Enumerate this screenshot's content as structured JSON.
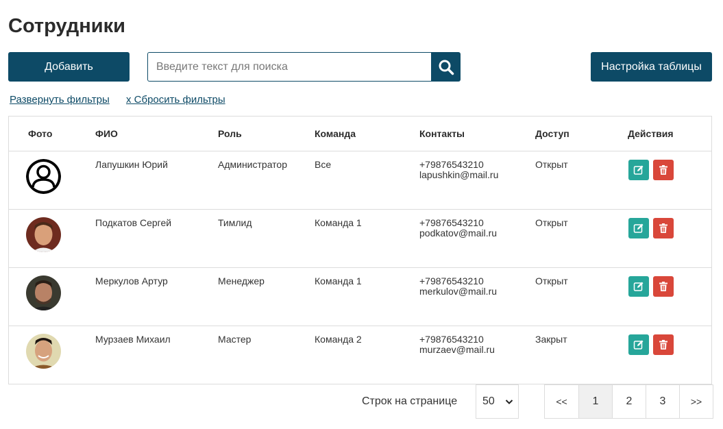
{
  "page": {
    "title": "Сотрудники"
  },
  "toolbar": {
    "add_label": "Добавить",
    "search_placeholder": "Введите текст для поиска",
    "search_value": "",
    "settings_label": "Настройка таблицы"
  },
  "filters": {
    "expand_label": "Развернуть фильтры",
    "reset_label": "x Сбросить фильтры"
  },
  "table": {
    "headers": [
      "Фото",
      "ФИО",
      "Роль",
      "Команда",
      "Контакты",
      "Доступ",
      "Действия"
    ],
    "rows": [
      {
        "name": "Лапушкин Юрий",
        "role": "Администратор",
        "team": "Все",
        "phone": "+79876543210",
        "email": "lapushkin@mail.ru",
        "access": "Открыт",
        "avatar": "default-user-icon"
      },
      {
        "name": "Подкатов Сергей",
        "role": "Тимлид",
        "team": "Команда 1",
        "phone": "+79876543210",
        "email": "podkatov@mail.ru",
        "access": "Открыт",
        "avatar": "user-photo"
      },
      {
        "name": "Меркулов Артур",
        "role": "Менеджер",
        "team": "Команда 1",
        "phone": "+79876543210",
        "email": "merkulov@mail.ru",
        "access": "Открыт",
        "avatar": "user-photo"
      },
      {
        "name": "Мурзаев Михаил",
        "role": "Мастер",
        "team": "Команда 2",
        "phone": "+79876543210",
        "email": "murzaev@mail.ru",
        "access": "Закрыт",
        "avatar": "user-photo"
      }
    ]
  },
  "footer": {
    "rows_per_page_label": "Строк на странице",
    "rows_per_page_value": "50",
    "pages": [
      "<<",
      "1",
      "2",
      "3",
      ">>"
    ],
    "current_page": "1"
  },
  "colors": {
    "primary": "#0d4a66",
    "edit": "#26a69a",
    "delete": "#d9473a"
  }
}
